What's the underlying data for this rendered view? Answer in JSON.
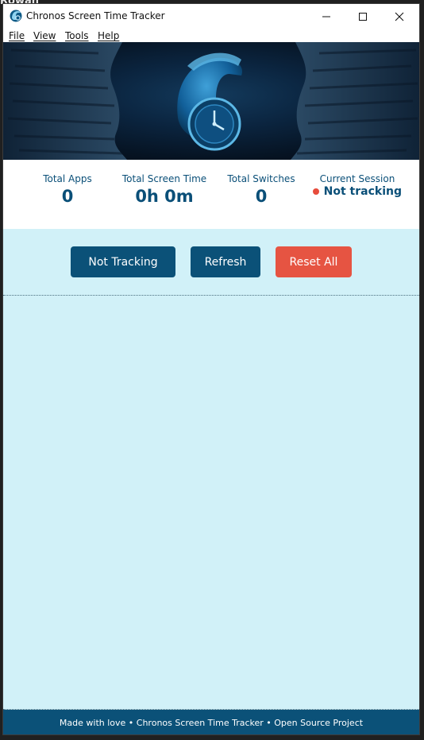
{
  "window": {
    "title": "Chronos Screen Time Tracker",
    "minimize_icon": "minimize-icon",
    "maximize_icon": "maximize-icon",
    "close_icon": "close-icon"
  },
  "desktop": {
    "fragment_text": "Rowan"
  },
  "menu": {
    "items": [
      "File",
      "View",
      "Tools",
      "Help"
    ]
  },
  "banner": {
    "image": "spartan-helmet-clock-logo"
  },
  "stats": {
    "total_apps": {
      "label": "Total Apps",
      "value": "0"
    },
    "total_screen_time": {
      "label": "Total Screen Time",
      "value": "0h 0m"
    },
    "total_switches": {
      "label": "Total Switches",
      "value": "0"
    },
    "current_session": {
      "label": "Current Session",
      "status": "Not tracking",
      "status_color": "#e74c3c"
    }
  },
  "buttons": {
    "tracking": "Not Tracking",
    "refresh": "Refresh",
    "reset": "Reset All"
  },
  "footer": {
    "text": "Made with love • Chronos Screen Time Tracker • Open Source Project"
  },
  "colors": {
    "primary": "#0b5178",
    "danger": "#e65442",
    "background": "#d1f1f8"
  }
}
